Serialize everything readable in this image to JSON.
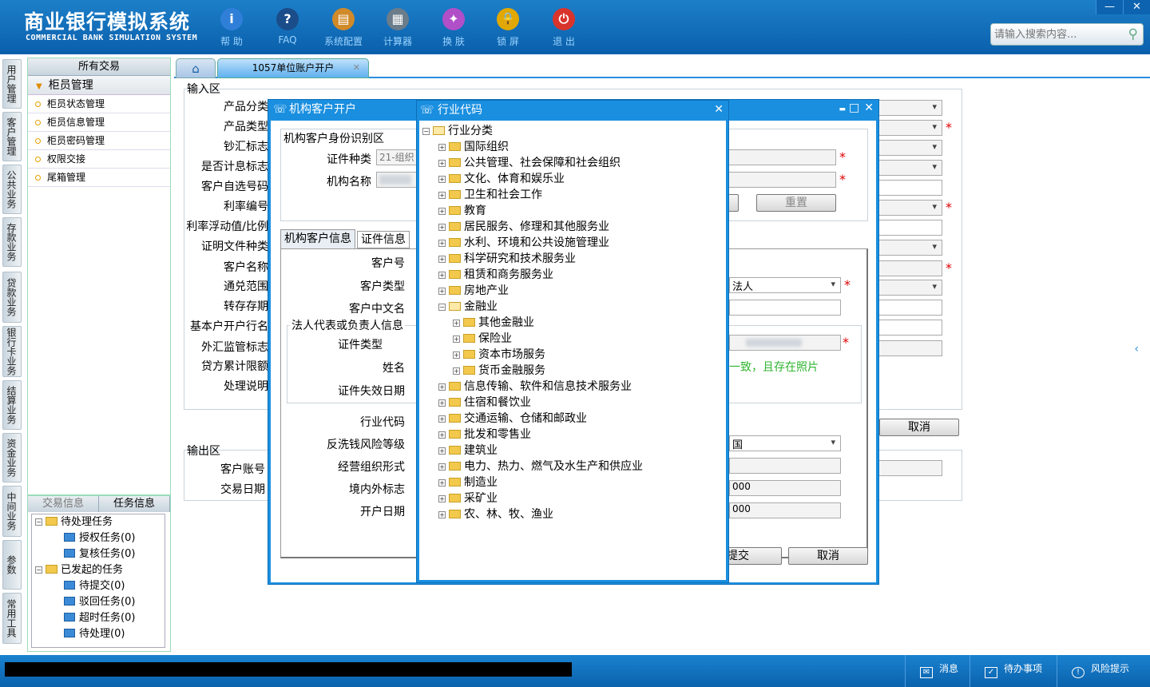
{
  "app": {
    "title_cn": "商业银行模拟系统",
    "title_en": "COMMERCIAL BANK SIMULATION SYSTEM"
  },
  "toolbar": [
    {
      "label": "帮 助",
      "icon": "info-icon",
      "glyph": "i",
      "color": "#2f7fd8"
    },
    {
      "label": "FAQ",
      "icon": "faq-icon",
      "glyph": "?",
      "color": "#1a4d8a"
    },
    {
      "label": "系统配置",
      "icon": "toolbox-icon",
      "glyph": "▤",
      "color": "#d08a2a"
    },
    {
      "label": "计算器",
      "icon": "calculator-icon",
      "glyph": "▦",
      "color": "#6b7c8a"
    },
    {
      "label": "换 肤",
      "icon": "shirt-icon",
      "glyph": "✦",
      "color": "#b04fc8"
    },
    {
      "label": "锁 屏",
      "icon": "lock-icon",
      "glyph": "🔒",
      "color": "#e0a800"
    },
    {
      "label": "退 出",
      "icon": "power-icon",
      "glyph": "⏻",
      "color": "#d9342b"
    }
  ],
  "window_controls": {
    "minimize": "—",
    "close": "✕"
  },
  "search": {
    "placeholder": "请输入搜索内容..."
  },
  "left_tabs": [
    "用户管理",
    "客户管理",
    "公共业务",
    "存款业务",
    "贷款业务",
    "银行卡业务",
    "结算业务",
    "资金业务",
    "中间业务",
    "参数",
    "常用工具"
  ],
  "left_panel": {
    "header": "所有交易",
    "group": "柜员管理",
    "items": [
      "柜员状态管理",
      "柜员信息管理",
      "柜员密码管理",
      "权限交接",
      "尾箱管理"
    ]
  },
  "task_panel": {
    "tabs": [
      "交易信息",
      "任务信息"
    ],
    "pending": "待处理任务",
    "pending_items": [
      "授权任务(0)",
      "复核任务(0)"
    ],
    "launched": "已发起的任务",
    "launched_items": [
      "待提交(0)",
      "驳回任务(0)",
      "超时任务(0)",
      "待处理(0)"
    ]
  },
  "tabs": {
    "active": "1057单位账户开户",
    "close": "✕"
  },
  "main": {
    "input_area": "输入区",
    "output_area": "输出区",
    "labels": [
      "产品分类",
      "产品类型",
      "钞汇标志",
      "是否计息标志",
      "客户自选号码",
      "利率编号",
      "利率浮动值/比例",
      "证明文件种类",
      "客户名称",
      "通兑范围",
      "转存存期",
      "基本户开户行名",
      "外汇监管标志",
      "贷方累计限额",
      "处理说明"
    ],
    "output_labels": [
      "客户账号",
      "交易日期"
    ],
    "cancel": "取消"
  },
  "dlg_customer": {
    "title": "机构客户开户",
    "section_id": "机构客户身份识别区",
    "id_type_label": "证件种类",
    "id_type_value": "21-组织",
    "org_name_label": "机构名称",
    "reset": "重置",
    "tabs": [
      "机构客户信息",
      "证件信息"
    ],
    "labels": [
      "客户号",
      "客户类型",
      "客户中文名"
    ],
    "customer_type_value": "法人",
    "legal_section": "法人代表或负责人信息",
    "legal_labels": [
      "证件类型",
      "姓名",
      "证件失效日期"
    ],
    "legal_hint": "一致，且存在照片",
    "lower_labels": [
      "行业代码",
      "反洗钱风险等级",
      "经营组织形式",
      "境内外标志",
      "开户日期"
    ],
    "country_value": "国",
    "date_value_1": "000",
    "date_value_2": "000",
    "submit": "提交",
    "cancel": "取消",
    "controls": {
      "minimize": "▬",
      "maximize": "□",
      "close": "✕"
    }
  },
  "dlg_industry": {
    "title": "行业代码",
    "close": "✕",
    "root": "行业分类",
    "top_items_before": [
      "国际组织",
      "公共管理、社会保障和社会组织",
      "文化、体育和娱乐业",
      "卫生和社会工作",
      "教育",
      "居民服务、修理和其他服务业",
      "水利、环境和公共设施管理业",
      "科学研究和技术服务业",
      "租赁和商务服务业",
      "房地产业"
    ],
    "expanded": "金融业",
    "children": [
      "其他金融业",
      "保险业",
      "资本市场服务",
      "货币金融服务"
    ],
    "top_items_after": [
      "信息传输、软件和信息技术服务业",
      "住宿和餐饮业",
      "交通运输、仓储和邮政业",
      "批发和零售业",
      "建筑业",
      "电力、热力、燃气及水生产和供应业",
      "制造业",
      "采矿业",
      "农、林、牧、渔业"
    ]
  },
  "status": {
    "messages": "消息",
    "todo": "待办事项",
    "risk": "风险提示"
  }
}
